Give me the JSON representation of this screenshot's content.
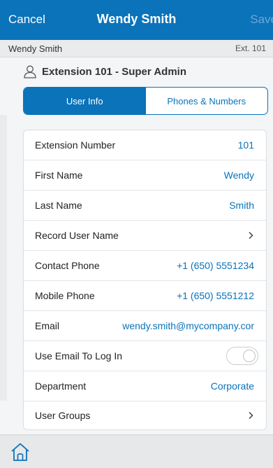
{
  "topbar": {
    "cancel_label": "Cancel",
    "title": "Wendy Smith",
    "save_label": "Save"
  },
  "subheader": {
    "name": "Wendy Smith",
    "extension": "Ext. 101"
  },
  "heading": {
    "icon": "user-icon",
    "text": "Extension 101 - Super Admin"
  },
  "tabs": [
    {
      "label": "User Info",
      "active": true
    },
    {
      "label": "Phones & Numbers",
      "active": false
    }
  ],
  "rows": [
    {
      "label": "Extension Number",
      "value": "101"
    },
    {
      "label": "First Name",
      "value": "Wendy"
    },
    {
      "label": "Last Name",
      "value": "Smith"
    },
    {
      "label": "Record User Name",
      "value": ""
    },
    {
      "label": "Contact Phone",
      "value": "+1 (650) 5551234"
    },
    {
      "label": "Mobile Phone",
      "value": "+1 (650) 5551212"
    },
    {
      "label": "Email",
      "value": "wendy.smith@mycompany.cor"
    },
    {
      "label": "Use Email To Log In",
      "value": "",
      "toggle": false
    },
    {
      "label": "Department",
      "value": "Corporate"
    },
    {
      "label": "User Groups",
      "value": ""
    }
  ],
  "bottombar": {
    "home_icon": "home-icon"
  },
  "colors": {
    "accent": "#0a73ba",
    "save_disabled": "#6fa6d3"
  }
}
